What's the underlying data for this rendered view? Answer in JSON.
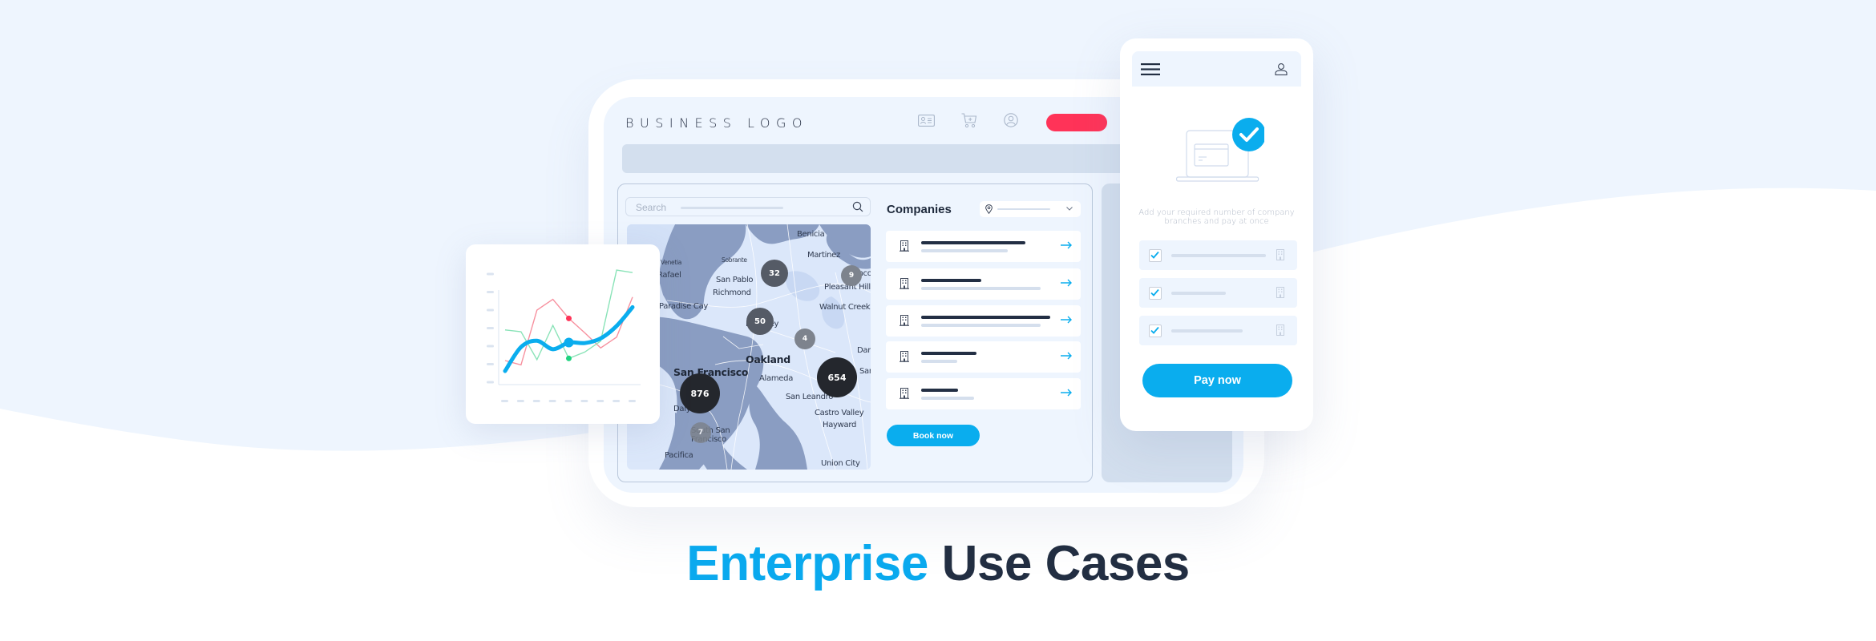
{
  "colors": {
    "background_light": "#eef5fe",
    "accent_blue": "#0aadee",
    "accent_red": "#ff3358",
    "dark_navy": "#222e42",
    "placeholder_gray": "#d5dfed",
    "map_water": "#8a9dc2",
    "map_land": "#dbe7fa"
  },
  "tablet": {
    "logo_text": "BUSINESS LOGO",
    "header_icons": [
      "id-card-icon",
      "cart-icon",
      "user-circle-icon"
    ],
    "search": {
      "placeholder": "Search",
      "icon": "search-icon"
    },
    "map": {
      "labels": [
        {
          "text": "Benicia",
          "kind": "normal"
        },
        {
          "text": "Martinez",
          "kind": "normal"
        },
        {
          "text": "Venetia",
          "kind": "small"
        },
        {
          "text": "Sobrante",
          "kind": "small"
        },
        {
          "text": "Rafael",
          "kind": "normal"
        },
        {
          "text": "San Pablo",
          "kind": "normal"
        },
        {
          "text": "Concord",
          "kind": "normal"
        },
        {
          "text": "Pleasant Hill",
          "kind": "normal"
        },
        {
          "text": "Richmond",
          "kind": "normal"
        },
        {
          "text": "Paradise Cay",
          "kind": "normal"
        },
        {
          "text": "Walnut Creek",
          "kind": "normal"
        },
        {
          "text": "Berkeley",
          "kind": "normal"
        },
        {
          "text": "Dan",
          "kind": "normal"
        },
        {
          "text": "Oakland",
          "kind": "big"
        },
        {
          "text": "San Francisco",
          "kind": "big"
        },
        {
          "text": "Alameda",
          "kind": "normal"
        },
        {
          "text": "San",
          "kind": "normal"
        },
        {
          "text": "San Leandro",
          "kind": "normal"
        },
        {
          "text": "Daly City",
          "kind": "normal"
        },
        {
          "text": "Castro Valley",
          "kind": "normal"
        },
        {
          "text": "Hayward",
          "kind": "normal"
        },
        {
          "text": "South San",
          "kind": "normal"
        },
        {
          "text": "Francisco",
          "kind": "normal"
        },
        {
          "text": "Pacifica",
          "kind": "normal"
        },
        {
          "text": "Union City",
          "kind": "normal"
        }
      ],
      "clusters": [
        {
          "count": "32",
          "tone": "dark-gray"
        },
        {
          "count": "9",
          "tone": "gray"
        },
        {
          "count": "50",
          "tone": "dark-gray"
        },
        {
          "count": "4",
          "tone": "gray"
        },
        {
          "count": "654",
          "tone": "black"
        },
        {
          "count": "876",
          "tone": "black"
        },
        {
          "count": "7",
          "tone": "gray"
        }
      ]
    },
    "companies": {
      "title": "Companies",
      "location_icon": "map-pin-icon",
      "dropdown_icon": "chevron-down-icon",
      "rows": [
        {
          "icon": "building-icon",
          "action_icon": "arrow-right-icon"
        },
        {
          "icon": "building-icon",
          "action_icon": "arrow-right-icon"
        },
        {
          "icon": "building-icon",
          "action_icon": "arrow-right-icon"
        },
        {
          "icon": "building-icon",
          "action_icon": "arrow-right-icon"
        },
        {
          "icon": "building-icon",
          "action_icon": "arrow-right-icon"
        }
      ],
      "book_button": "Book now"
    }
  },
  "phone": {
    "menu_icon": "hamburger-menu-icon",
    "user_icon": "user-icon",
    "illustration": "laptop-card-checkmark-illustration",
    "description_line1": "Add your required number of company",
    "description_line2": "branches and pay at once",
    "checklist": [
      {
        "checked": true,
        "icon": "building-icon"
      },
      {
        "checked": true,
        "icon": "building-icon"
      },
      {
        "checked": true,
        "icon": "building-icon"
      }
    ],
    "pay_button": "Pay now"
  },
  "chart_data": {
    "type": "line",
    "title": "",
    "xlabel": "",
    "ylabel": "",
    "x": [
      1,
      2,
      3,
      4,
      5,
      6,
      7,
      8,
      9
    ],
    "ylim": [
      0,
      6
    ],
    "grid": false,
    "tick_labels_placeholder": true,
    "series": [
      {
        "name": "red",
        "color": "#f7919f",
        "smooth": false,
        "values": [
          1.2,
          0.96,
          4.0,
          4.6,
          3.54,
          2.74,
          1.9,
          2.5,
          4.72
        ],
        "highlight_index": 4,
        "highlight_color": "#ff3358"
      },
      {
        "name": "green",
        "color": "#8ae3b8",
        "smooth": false,
        "values": [
          2.9,
          2.8,
          1.25,
          3.15,
          1.32,
          1.67,
          2.28,
          6.22,
          6.08
        ],
        "highlight_index": 4,
        "highlight_color": "#1fd37f"
      },
      {
        "name": "blue",
        "color": "#0aadee",
        "smooth": true,
        "values": [
          0.62,
          1.95,
          2.3,
          1.83,
          2.2,
          2.17,
          2.43,
          3.12,
          4.16
        ],
        "highlight_index": 4,
        "highlight_color": "#0aadee"
      }
    ]
  },
  "headline": {
    "highlight": "Enterprise",
    "rest": " Use Cases"
  }
}
